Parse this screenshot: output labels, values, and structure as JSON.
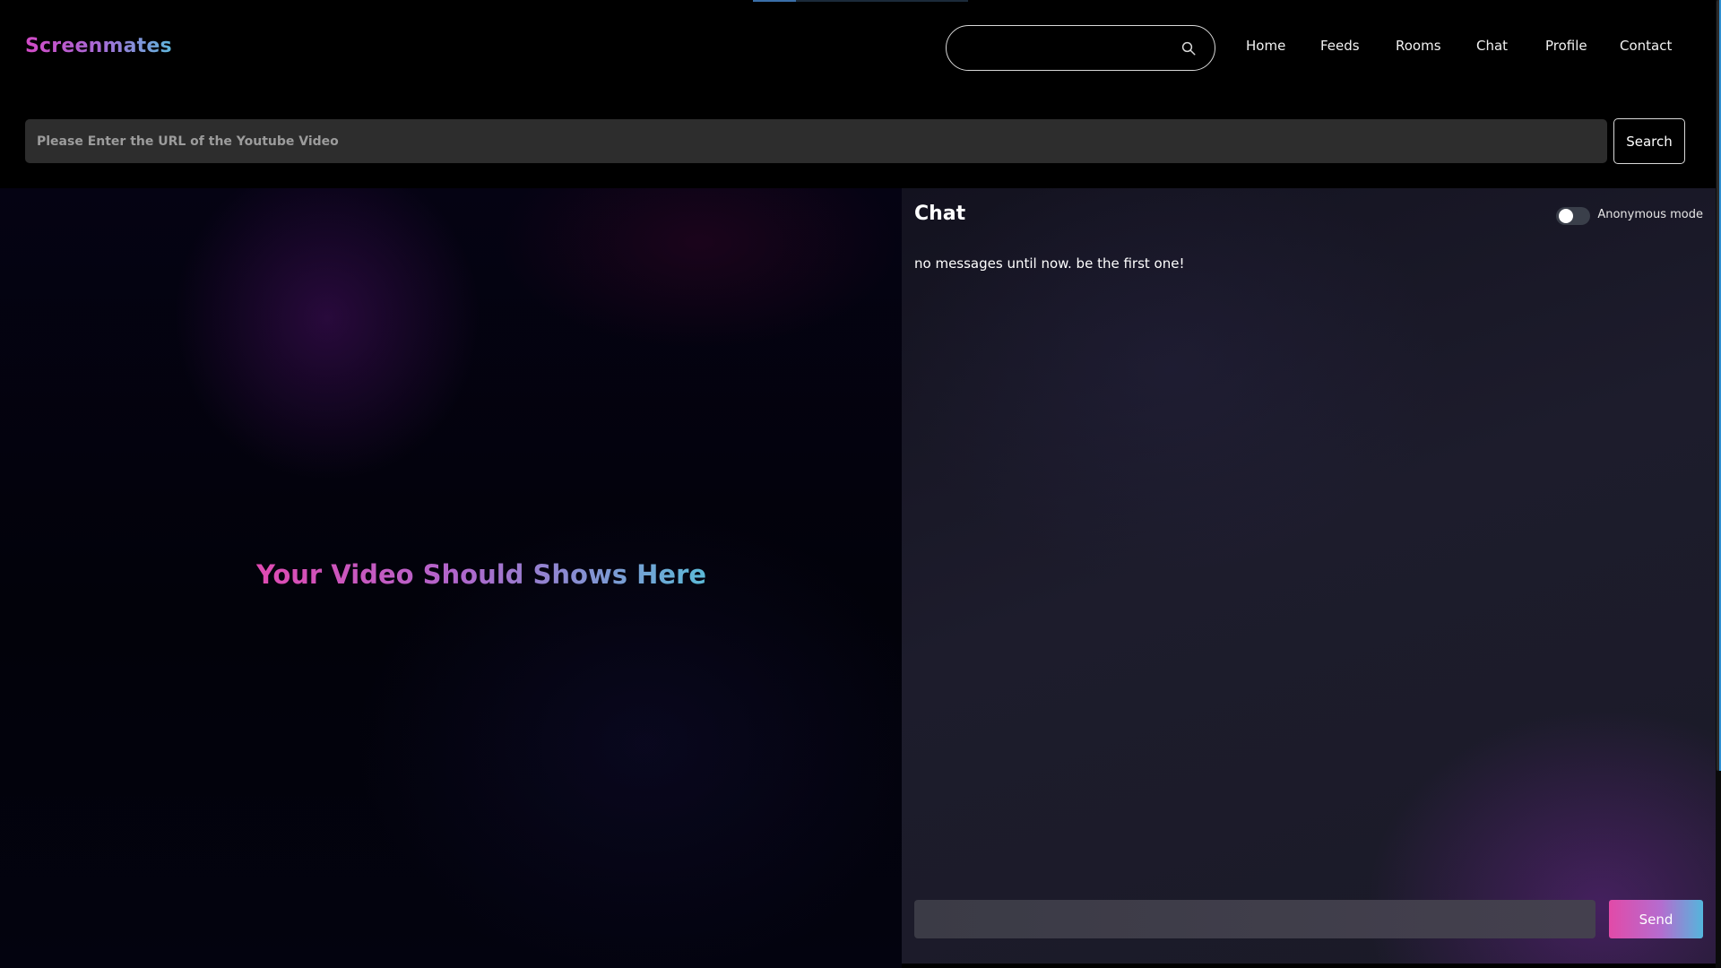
{
  "app": {
    "title": "Screenmates"
  },
  "header": {
    "search": {
      "value": "",
      "placeholder": ""
    },
    "nav": [
      {
        "label": "Home"
      },
      {
        "label": "Feeds"
      },
      {
        "label": "Rooms"
      },
      {
        "label": "Chat"
      },
      {
        "label": "Profile"
      },
      {
        "label": "Contact"
      }
    ]
  },
  "url_bar": {
    "placeholder": "Please Enter the URL of the Youtube Video",
    "value": "",
    "search_label": "Search"
  },
  "video": {
    "placeholder_text": "Your Video Should Shows Here"
  },
  "chat": {
    "title": "Chat",
    "anonymous_label": "Anonymous mode",
    "anonymous_enabled": false,
    "empty_text": "no messages until now. be the first one!",
    "input_value": "",
    "send_label": "Send"
  },
  "colors": {
    "brand_gradient_start": "#d24ac6",
    "brand_gradient_end": "#5fb7dc",
    "background": "#000000",
    "chat_panel": "#1d1c2c"
  },
  "icons": {
    "search": "search-icon"
  }
}
